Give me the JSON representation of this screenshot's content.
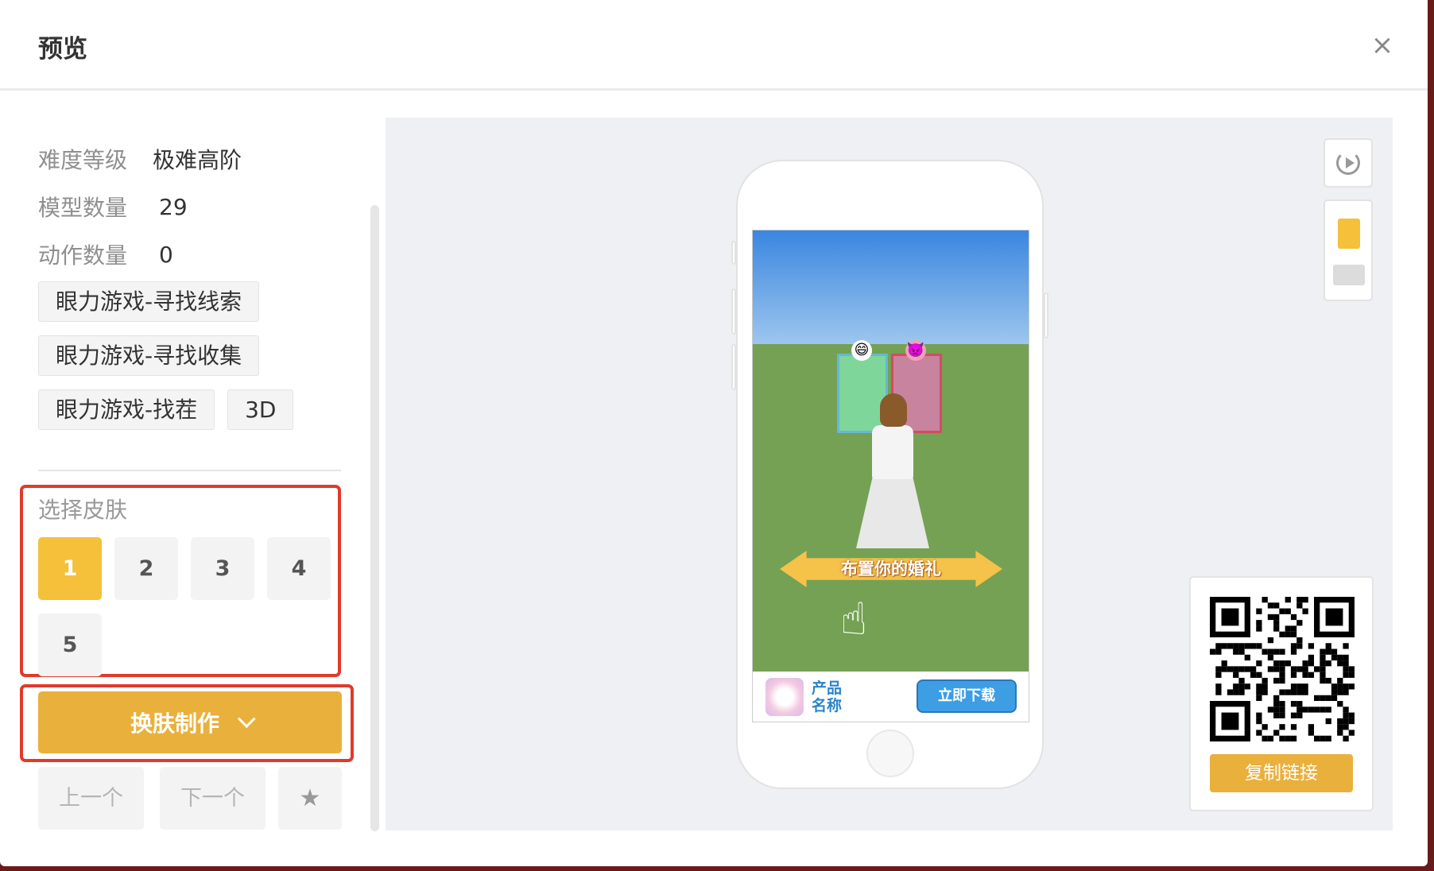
{
  "modal": {
    "title": "预览",
    "close_symbol": "×"
  },
  "info": {
    "difficulty_label": "难度等级",
    "difficulty_value": "极难高阶",
    "models_label": "模型数量",
    "models_value": "29",
    "actions_label": "动作数量",
    "actions_value": "0"
  },
  "tags": [
    "眼力游戏-寻找线索",
    "眼力游戏-寻找收集",
    "眼力游戏-找茬",
    "3D"
  ],
  "skin": {
    "title": "选择皮肤",
    "options": [
      "1",
      "2",
      "3",
      "4",
      "5"
    ],
    "selected": "1"
  },
  "reskin_button": {
    "label": "换肤制作"
  },
  "navigation": {
    "prev_label": "上一个",
    "next_label": "下一个",
    "favorite_symbol": "★"
  },
  "preview": {
    "banner_text": "布置你的婚礼",
    "ad_product_name": "产品名称",
    "ad_download_label": "立即下载",
    "emoji_left": "😄",
    "emoji_right": "👿",
    "hand_symbol": "☝"
  },
  "tools": {
    "replay_icon": "replay-icon",
    "device_portrait": "portrait-device-icon",
    "device_landscape": "landscape-device-icon"
  },
  "qr": {
    "copy_label": "复制链接"
  },
  "colors": {
    "accent": "#eab03c",
    "selected_skin": "#f5c03a",
    "highlight": "#e03a2b"
  }
}
